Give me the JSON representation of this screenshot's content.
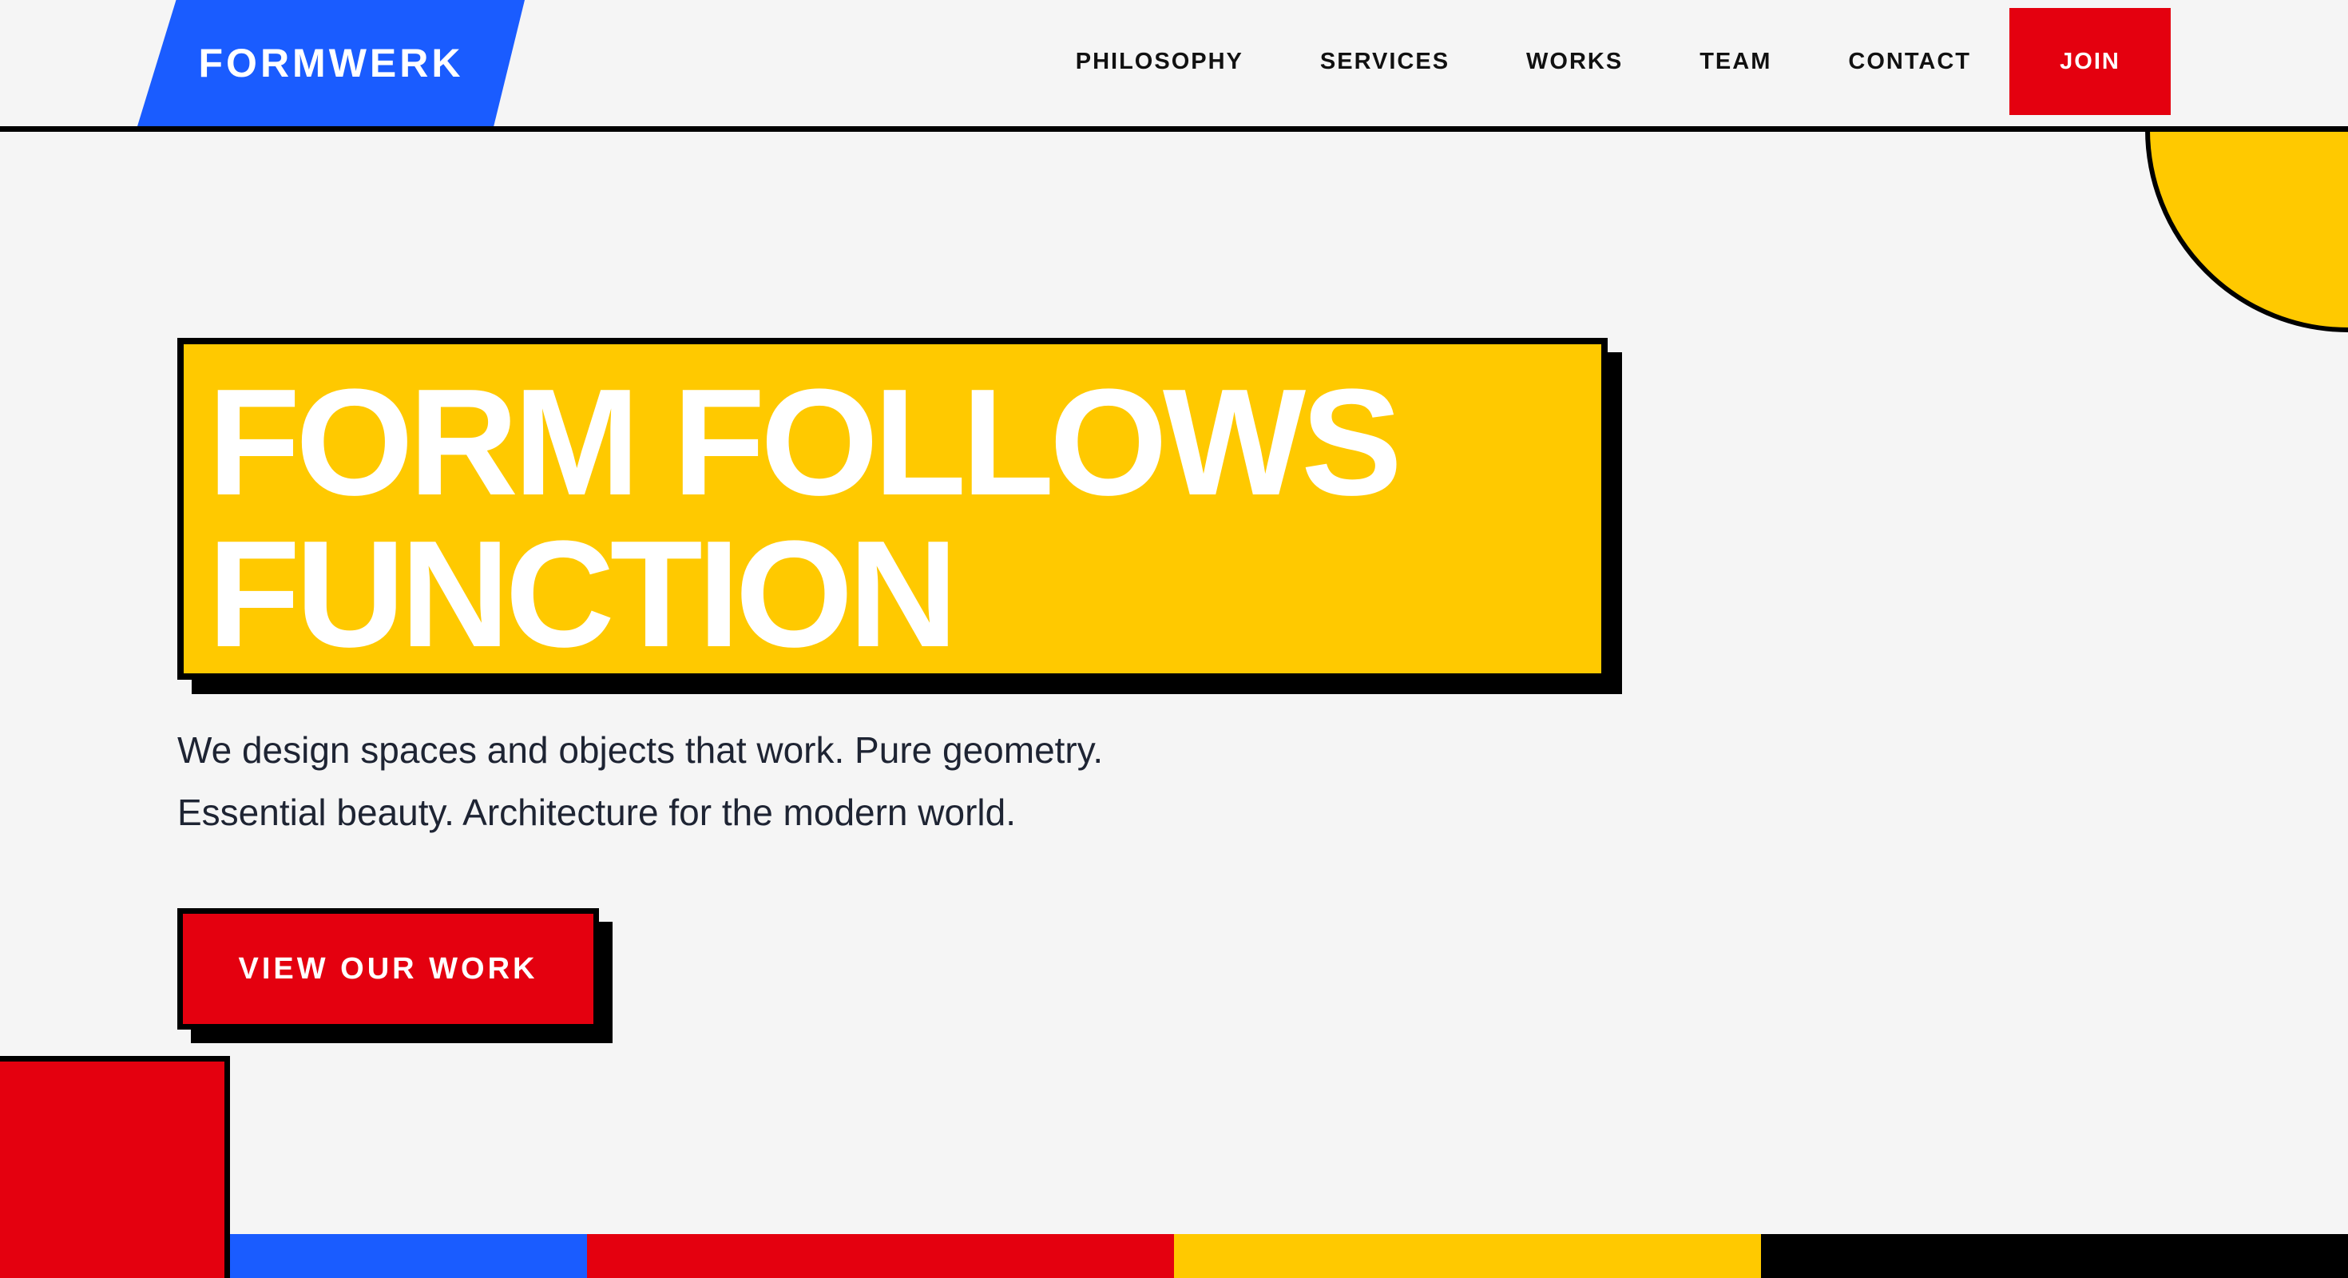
{
  "brand": {
    "name": "FORMWERK",
    "color": "#1a5cff"
  },
  "nav": {
    "items": [
      {
        "label": "PHILOSOPHY"
      },
      {
        "label": "SERVICES"
      },
      {
        "label": "WORKS"
      },
      {
        "label": "TEAM"
      },
      {
        "label": "CONTACT"
      }
    ],
    "join_label": "JOIN"
  },
  "hero": {
    "title_lines": [
      "FORM FOLLOWS",
      "FUNCTION"
    ],
    "subtitle_lines": [
      "We design spaces and objects that work. Pure geometry.",
      "Essential beauty. Architecture for the modern world."
    ],
    "cta_label": "VIEW OUR WORK"
  },
  "palette": {
    "blue": "#1a5cff",
    "red": "#e4000f",
    "yellow": "#ffc900",
    "black": "#000000",
    "background": "#f5f5f5"
  },
  "color_bar": [
    "#1a5cff",
    "#e4000f",
    "#ffc900",
    "#000000"
  ]
}
